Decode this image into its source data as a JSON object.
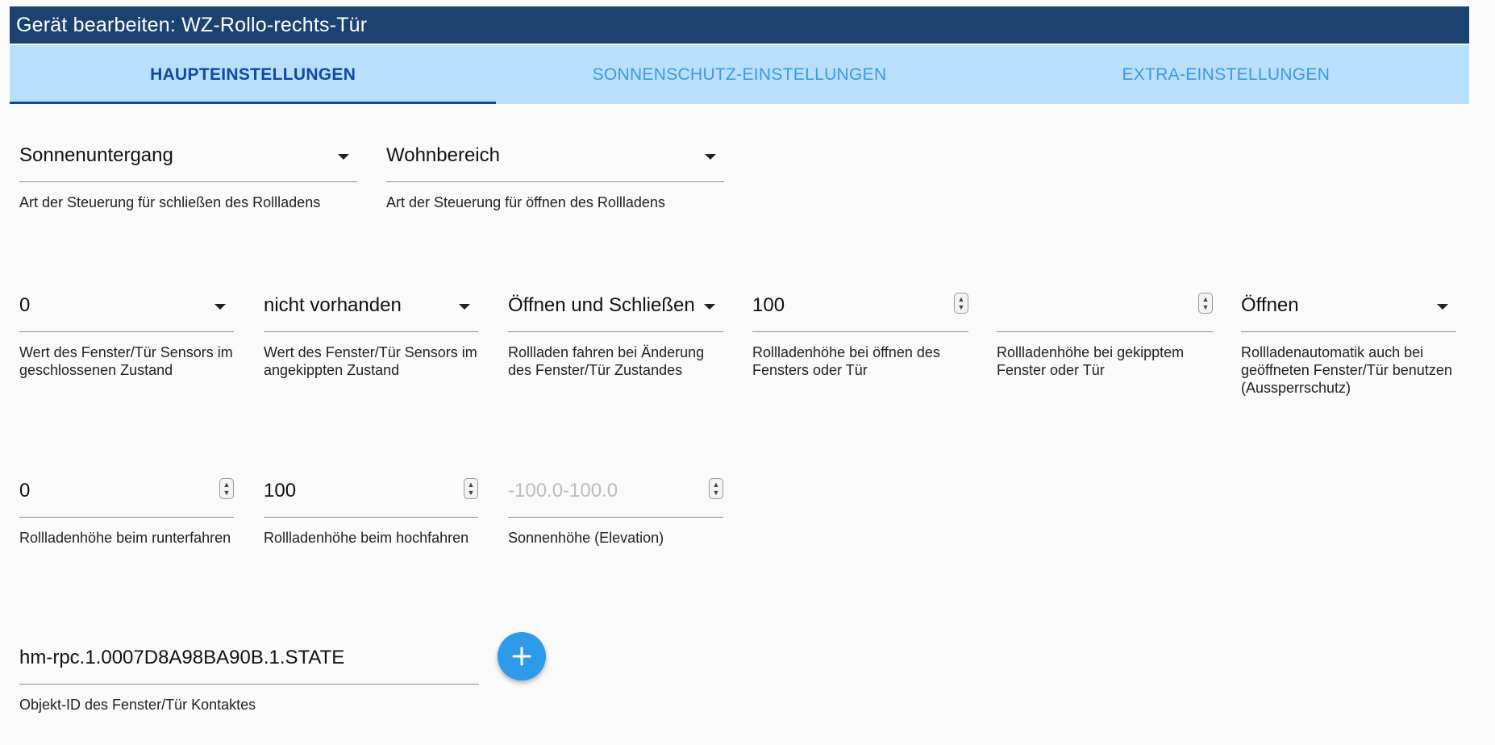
{
  "header": {
    "title": "Gerät bearbeiten: WZ-Rollo-rechts-Tür"
  },
  "tabs": [
    {
      "label": "HAUPTEINSTELLUNGEN",
      "active": true
    },
    {
      "label": "SONNENSCHUTZ-EINSTELLUNGEN",
      "active": false
    },
    {
      "label": "EXTRA-EINSTELLUNGEN",
      "active": false
    }
  ],
  "fields": {
    "close_control": {
      "value": "Sonnenuntergang",
      "helper": "Art der Steuerung für schließen des Rollladens"
    },
    "open_control": {
      "value": "Wohnbereich",
      "helper": "Art der Steuerung für öffnen des Rollladens"
    },
    "sensor_closed": {
      "value": "0",
      "helper": "Wert des Fenster/Tür Sensors im geschlossenen Zustand"
    },
    "sensor_tilted": {
      "value": "nicht vorhanden",
      "helper": "Wert des Fenster/Tür Sensors im angekippten Zustand"
    },
    "move_on_change": {
      "value": "Öffnen und Schließen",
      "helper": "Rollladen fahren bei Änderung des Fenster/Tür Zustandes"
    },
    "height_open_window": {
      "value": "100",
      "helper": "Rollladenhöhe bei öffnen des Fensters oder Tür"
    },
    "height_tilted_window": {
      "value": "",
      "helper": "Rollladenhöhe bei gekipptem Fenster oder Tür"
    },
    "lockout_protection": {
      "value": "Öffnen",
      "helper": "Rollladenautomatik auch bei geöffneten Fenster/Tür benutzen (Aussperrschutz)"
    },
    "height_down": {
      "value": "0",
      "helper": "Rollladenhöhe beim runterfahren"
    },
    "height_up": {
      "value": "100",
      "helper": "Rollladenhöhe beim hochfahren"
    },
    "elevation": {
      "value": "",
      "placeholder": "-100.0-100.0",
      "helper": "Sonnenhöhe (Elevation)"
    },
    "object_id": {
      "value": "hm-rpc.1.0007D8A98BA90B.1.STATE",
      "helper": "Objekt-ID des Fenster/Tür Kontaktes"
    }
  },
  "add_button": {
    "icon": "plus-icon"
  },
  "colors": {
    "header_bg": "#1c4370",
    "tabs_bg": "#b8dffb",
    "tab_active": "#1346a6",
    "tab_inactive": "#3b9ae6",
    "fab": "#2d9be9"
  }
}
